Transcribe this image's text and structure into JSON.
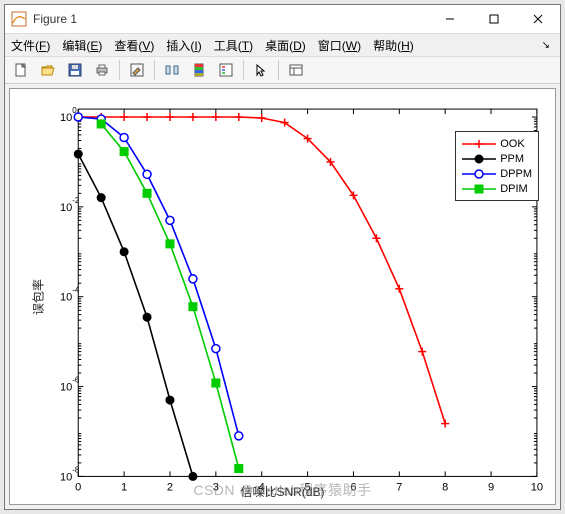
{
  "window": {
    "title": "Figure 1",
    "menus": [
      {
        "label": "文件",
        "mn": "F"
      },
      {
        "label": "编辑",
        "mn": "E"
      },
      {
        "label": "查看",
        "mn": "V"
      },
      {
        "label": "插入",
        "mn": "I"
      },
      {
        "label": "工具",
        "mn": "T"
      },
      {
        "label": "桌面",
        "mn": "D"
      },
      {
        "label": "窗口",
        "mn": "W"
      },
      {
        "label": "帮助",
        "mn": "H"
      }
    ],
    "toolbar": [
      "new",
      "open",
      "save",
      "print",
      "|",
      "edit",
      "|",
      "rect1",
      "rect2",
      "insert-legend",
      "|",
      "pointer",
      "|",
      "insert-colorbar"
    ]
  },
  "chart_data": {
    "type": "line",
    "xlabel": "信噪比SNR(dB)",
    "ylabel": "误包率",
    "xlim": [
      0,
      10
    ],
    "ylim": [
      1e-08,
      1.5
    ],
    "yscale": "log",
    "xticks": [
      0,
      1,
      2,
      3,
      4,
      5,
      6,
      7,
      8,
      9,
      10
    ],
    "yticks": [
      1,
      0.01,
      0.0001,
      1e-06,
      1e-08
    ],
    "yticklabels": [
      "10^{0}",
      "10^{-2}",
      "10^{-4}",
      "10^{-6}",
      "10^{-8}"
    ],
    "watermark": "CSDN @Matlab程序猿助手",
    "series": [
      {
        "name": "OOK",
        "color": "#ff0000",
        "marker": "plus",
        "x": [
          0,
          0.5,
          1,
          1.5,
          2,
          2.5,
          3,
          3.5,
          4,
          4.5,
          5,
          5.5,
          6,
          6.5,
          7,
          7.5,
          8
        ],
        "y": [
          1,
          1,
          1,
          1,
          1,
          1,
          1,
          1,
          0.95,
          0.75,
          0.33,
          0.1,
          0.018,
          0.002,
          0.00015,
          6e-06,
          1.5e-07
        ]
      },
      {
        "name": "PPM",
        "color": "#000000",
        "marker": "circlef",
        "x": [
          0,
          0.5,
          1,
          1.5,
          2,
          2.5
        ],
        "y": [
          0.15,
          0.016,
          0.001,
          3.5e-05,
          5e-07,
          3e-09
        ]
      },
      {
        "name": "DPPM",
        "color": "#0000ff",
        "marker": "circleo",
        "x": [
          0,
          0.5,
          1,
          1.5,
          2,
          2.5,
          3,
          3.5
        ],
        "y": [
          1,
          0.9,
          0.35,
          0.053,
          0.005,
          0.00025,
          7e-06,
          8e-08
        ]
      },
      {
        "name": "DPIM",
        "color": "#00cc00",
        "marker": "squaref",
        "x": [
          0.5,
          1,
          1.5,
          2,
          2.5,
          3,
          3.5
        ],
        "y": [
          0.7,
          0.17,
          0.02,
          0.0015,
          6e-05,
          1.2e-06,
          1.5e-08
        ]
      }
    ]
  }
}
